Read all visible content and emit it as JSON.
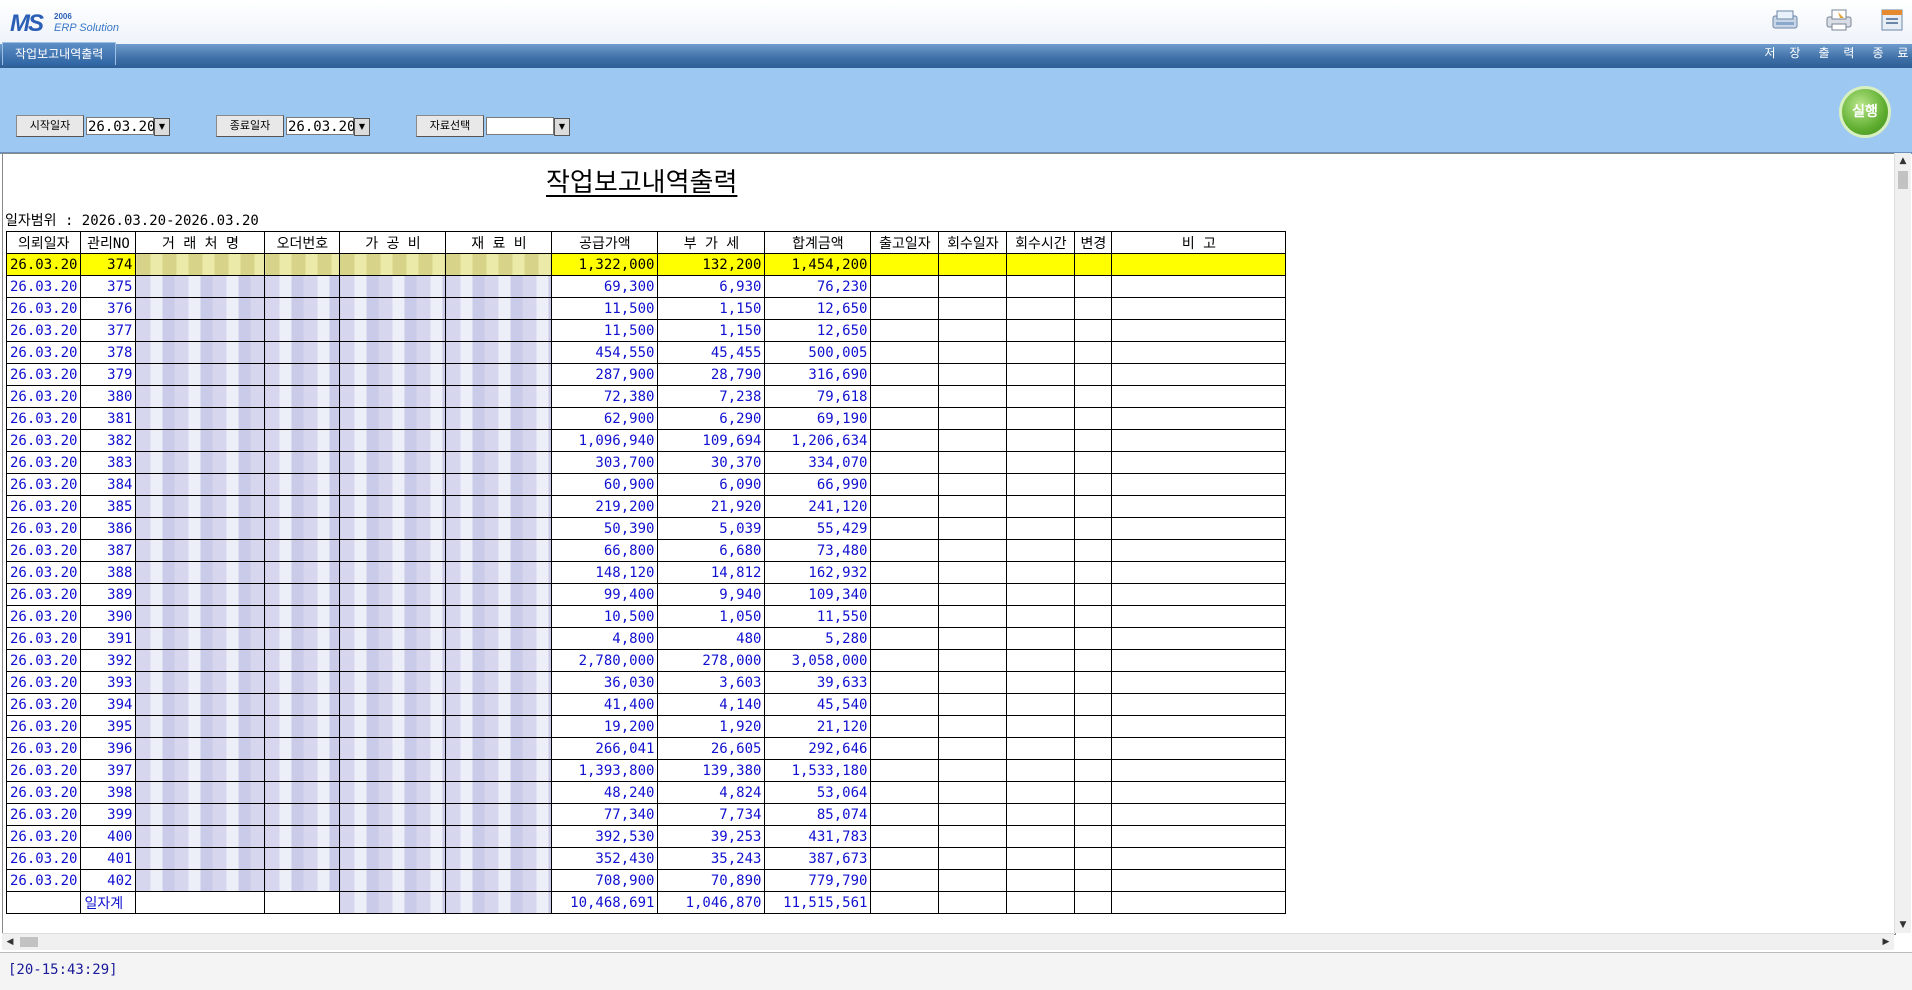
{
  "app": {
    "logo_mark": "MS",
    "logo_year": "2006",
    "logo_text": "ERP Solution",
    "window_tab": "작업보고내역출력"
  },
  "toolbar": {
    "save_label": "저 장",
    "print_label": "출 력",
    "exit_label": "종 료"
  },
  "filter": {
    "start_label": "시작일자",
    "start_value": "26.03.20",
    "end_label": "종료일자",
    "end_value": "26.03.20",
    "data_select_label": "자료선택",
    "data_select_value": "",
    "run_label": "실행"
  },
  "report": {
    "title": "작업보고내역출력",
    "range": "일자범위 : 2026.03.20-2026.03.20",
    "columns": [
      "의뢰일자",
      "관리NO",
      "거 래 처 명",
      "오더번호",
      "가 공 비",
      "재 료 비",
      "공급가액",
      "부 가 세",
      "합계금액",
      "출고일자",
      "회수일자",
      "회수시간",
      "변경",
      "비    고"
    ],
    "rows": [
      {
        "date": "26.03.20",
        "no": "374",
        "supply": "1,322,000",
        "vat": "132,200",
        "total": "1,454,200"
      },
      {
        "date": "26.03.20",
        "no": "375",
        "supply": "69,300",
        "vat": "6,930",
        "total": "76,230"
      },
      {
        "date": "26.03.20",
        "no": "376",
        "supply": "11,500",
        "vat": "1,150",
        "total": "12,650"
      },
      {
        "date": "26.03.20",
        "no": "377",
        "supply": "11,500",
        "vat": "1,150",
        "total": "12,650"
      },
      {
        "date": "26.03.20",
        "no": "378",
        "supply": "454,550",
        "vat": "45,455",
        "total": "500,005"
      },
      {
        "date": "26.03.20",
        "no": "379",
        "supply": "287,900",
        "vat": "28,790",
        "total": "316,690"
      },
      {
        "date": "26.03.20",
        "no": "380",
        "supply": "72,380",
        "vat": "7,238",
        "total": "79,618"
      },
      {
        "date": "26.03.20",
        "no": "381",
        "supply": "62,900",
        "vat": "6,290",
        "total": "69,190"
      },
      {
        "date": "26.03.20",
        "no": "382",
        "supply": "1,096,940",
        "vat": "109,694",
        "total": "1,206,634"
      },
      {
        "date": "26.03.20",
        "no": "383",
        "supply": "303,700",
        "vat": "30,370",
        "total": "334,070"
      },
      {
        "date": "26.03.20",
        "no": "384",
        "supply": "60,900",
        "vat": "6,090",
        "total": "66,990"
      },
      {
        "date": "26.03.20",
        "no": "385",
        "supply": "219,200",
        "vat": "21,920",
        "total": "241,120"
      },
      {
        "date": "26.03.20",
        "no": "386",
        "supply": "50,390",
        "vat": "5,039",
        "total": "55,429"
      },
      {
        "date": "26.03.20",
        "no": "387",
        "supply": "66,800",
        "vat": "6,680",
        "total": "73,480"
      },
      {
        "date": "26.03.20",
        "no": "388",
        "supply": "148,120",
        "vat": "14,812",
        "total": "162,932"
      },
      {
        "date": "26.03.20",
        "no": "389",
        "supply": "99,400",
        "vat": "9,940",
        "total": "109,340"
      },
      {
        "date": "26.03.20",
        "no": "390",
        "supply": "10,500",
        "vat": "1,050",
        "total": "11,550"
      },
      {
        "date": "26.03.20",
        "no": "391",
        "supply": "4,800",
        "vat": "480",
        "total": "5,280"
      },
      {
        "date": "26.03.20",
        "no": "392",
        "supply": "2,780,000",
        "vat": "278,000",
        "total": "3,058,000"
      },
      {
        "date": "26.03.20",
        "no": "393",
        "supply": "36,030",
        "vat": "3,603",
        "total": "39,633"
      },
      {
        "date": "26.03.20",
        "no": "394",
        "supply": "41,400",
        "vat": "4,140",
        "total": "45,540"
      },
      {
        "date": "26.03.20",
        "no": "395",
        "supply": "19,200",
        "vat": "1,920",
        "total": "21,120"
      },
      {
        "date": "26.03.20",
        "no": "396",
        "supply": "266,041",
        "vat": "26,605",
        "total": "292,646"
      },
      {
        "date": "26.03.20",
        "no": "397",
        "supply": "1,393,800",
        "vat": "139,380",
        "total": "1,533,180"
      },
      {
        "date": "26.03.20",
        "no": "398",
        "supply": "48,240",
        "vat": "4,824",
        "total": "53,064"
      },
      {
        "date": "26.03.20",
        "no": "399",
        "supply": "77,340",
        "vat": "7,734",
        "total": "85,074"
      },
      {
        "date": "26.03.20",
        "no": "400",
        "supply": "392,530",
        "vat": "39,253",
        "total": "431,783"
      },
      {
        "date": "26.03.20",
        "no": "401",
        "supply": "352,430",
        "vat": "35,243",
        "total": "387,673"
      },
      {
        "date": "26.03.20",
        "no": "402",
        "supply": "708,900",
        "vat": "70,890",
        "total": "779,790"
      }
    ],
    "total_row": {
      "label": "일자계",
      "supply": "10,468,691",
      "vat": "1,046,870",
      "total": "11,515,561"
    }
  },
  "status": {
    "text": "[20-15:43:29]"
  },
  "colors": {
    "selected_row": "#ffff00",
    "filter_bg": "#9cc8f2",
    "title_bar": "#3e6fa6",
    "value_text": "#1010d0"
  }
}
